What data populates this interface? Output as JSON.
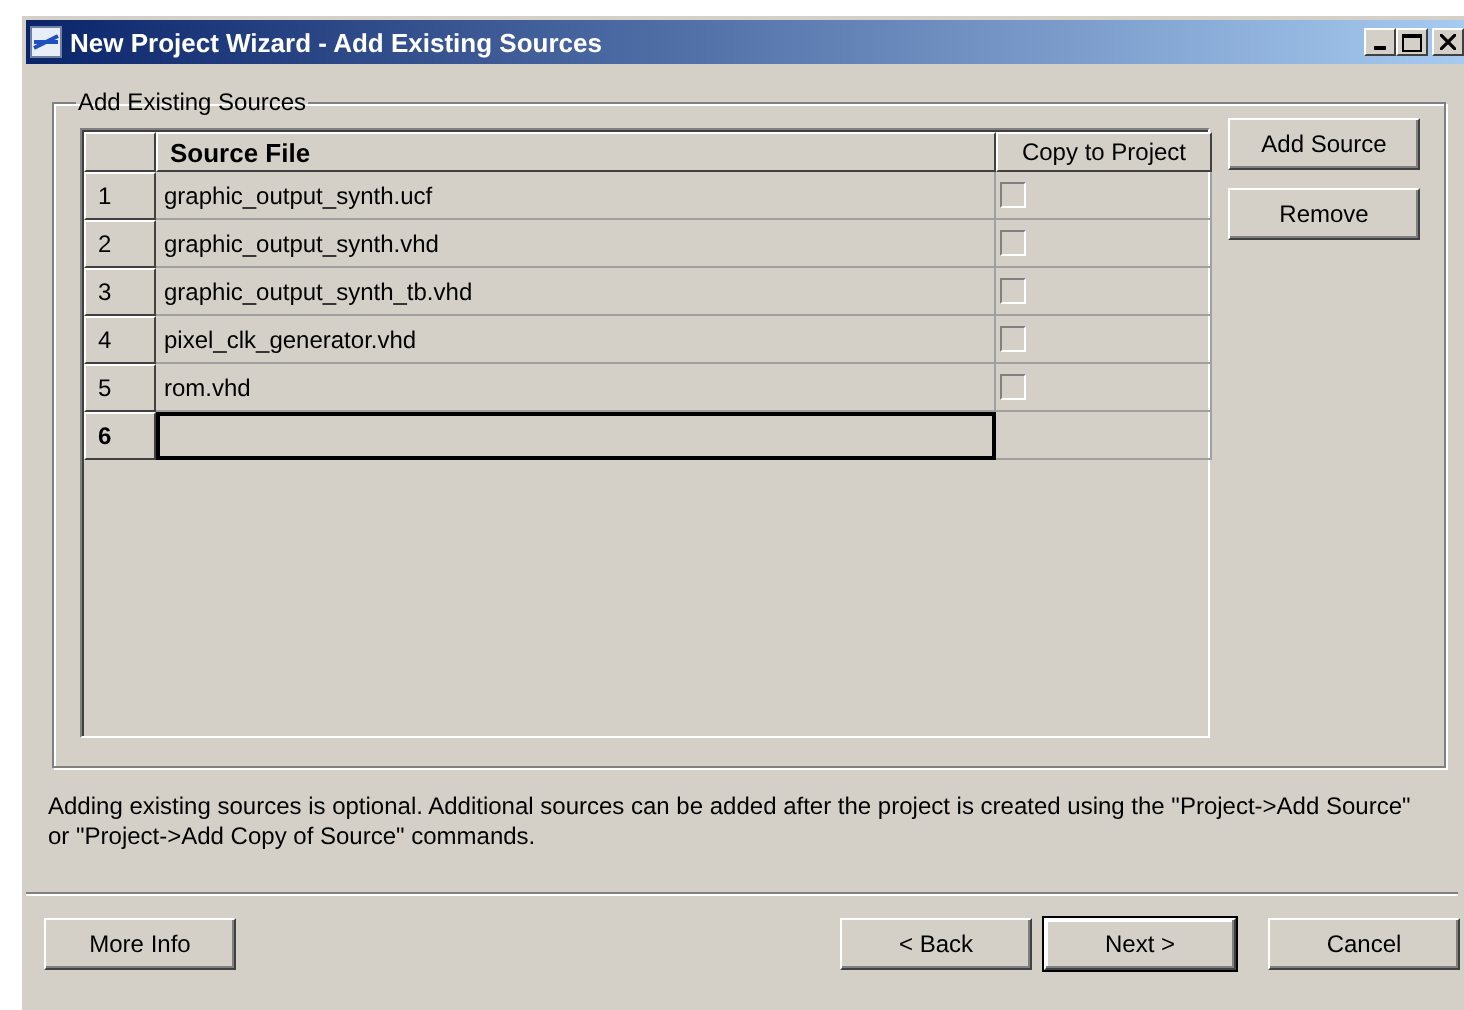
{
  "window": {
    "title": "New Project Wizard - Add Existing Sources"
  },
  "group": {
    "title": "Add Existing Sources"
  },
  "table": {
    "columns": [
      "Source File",
      "Copy to Project"
    ],
    "rows": [
      {
        "kind": "file",
        "number": "1",
        "source": "graphic_output_synth.ucf",
        "checked": false,
        "selected": false
      },
      {
        "kind": "file",
        "number": "2",
        "source": "graphic_output_synth.vhd",
        "checked": false,
        "selected": false
      },
      {
        "kind": "file",
        "number": "3",
        "source": "graphic_output_synth_tb.vhd",
        "checked": false,
        "selected": false
      },
      {
        "kind": "file",
        "number": "4",
        "source": "pixel_clk_generator.vhd",
        "checked": false,
        "selected": false
      },
      {
        "kind": "file",
        "number": "5",
        "source": "rom.vhd",
        "checked": false,
        "selected": false
      },
      {
        "kind": "new",
        "number": "6",
        "selected": true
      }
    ]
  },
  "side_buttons": [
    "Add Source",
    "Remove"
  ],
  "note": "Adding existing sources is optional. Additional sources can be added after the project is created using the \"Project->Add Source\" or \"Project->Add Copy of Source\" commands.",
  "footer_buttons": [
    {
      "label": "More Info",
      "default": false
    },
    {
      "label": "< Back",
      "default": false
    },
    {
      "label": "Next >",
      "default": true
    },
    {
      "label": "Cancel",
      "default": false
    }
  ]
}
